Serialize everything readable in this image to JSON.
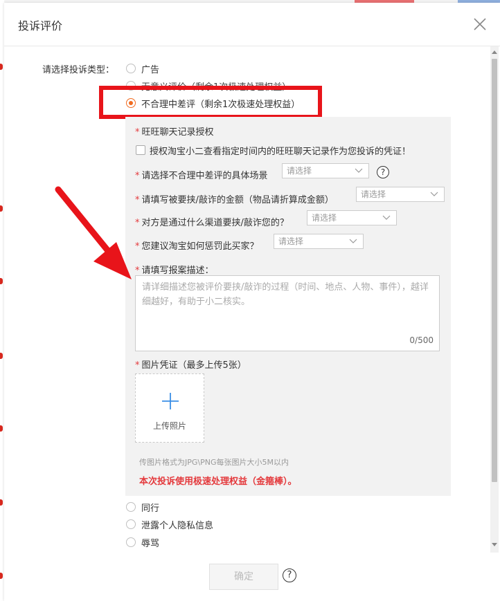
{
  "dialog": {
    "title": "投诉评价",
    "type_label": "请选择投诉类型：",
    "options": [
      {
        "label": "广告",
        "checked": false
      },
      {
        "label": "无意义评价（剩余1次极速处理权益）",
        "checked": false
      },
      {
        "label": "不合理中差评（剩余1次极速处理权益）",
        "checked": true
      },
      {
        "label": "同行",
        "checked": false
      },
      {
        "label": "泄露个人隐私信息",
        "checked": false
      },
      {
        "label": "辱骂",
        "checked": false
      }
    ],
    "panel": {
      "chat_auth_title": "旺旺聊天记录授权",
      "chat_auth_checkbox": "授权淘宝小二查看指定时间内的旺旺聊天记录作为您投诉的凭证！",
      "scene_label": "请选择不合理中差评的具体场景",
      "scene_select": "请选择",
      "amount_label": "请填写被要挟/敲诈的金额（物品请折算成金额）",
      "amount_select": "请选择",
      "channel_label": "对方是通过什么渠道要挟/敲诈您的？",
      "channel_select": "请选择",
      "punish_label": "您建议淘宝如何惩罚此买家？",
      "punish_select": "请选择",
      "desc_label": "请填写报案描述：",
      "desc_placeholder": "请详细描述您被评价要挟/敲诈的过程（时间、地点、人物、事件），越详细越好，有助于小二核实。",
      "desc_counter": "0/500",
      "evidence_label": "图片凭证（最多上传5张）",
      "upload_text": "上传照片",
      "upload_hint": "传图片格式为JPG\\PNG每张图片大小5M以内",
      "notice": "本次投诉使用极速处理权益（金箍棒）。"
    },
    "submit_label": "确定",
    "help_glyph": "?",
    "required_mark": "*"
  },
  "colors": {
    "accent": "#f06b20",
    "annotation": "#e8141a",
    "required": "#e4393c"
  },
  "icons": {
    "close": "close-icon",
    "chevron": "chevron-down-icon",
    "help": "question-circle-icon",
    "plus": "plus-icon"
  }
}
